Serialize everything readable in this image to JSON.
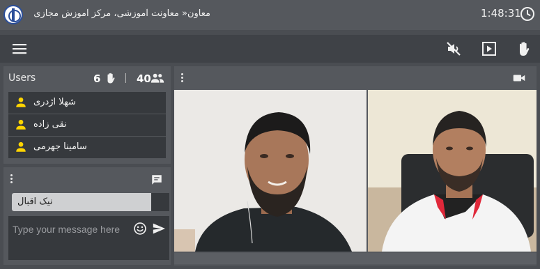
{
  "window": {
    "title": "معاون« معاونت آموزشی، مرکز آموزش مجازی",
    "clock": "1:48:31",
    "logo_icon": "university-seal-logo",
    "clock_icon": "clock-icon"
  },
  "toolbar": {
    "menu_icon": "hamburger-menu-icon",
    "mute_icon": "volume-off-icon",
    "play_icon": "play-box-icon",
    "hand_icon": "raise-hand-icon"
  },
  "users": {
    "title": "Users",
    "raised_hands_count": "6",
    "participants_count": "40",
    "list": [
      {
        "name": "شهلا اژدری",
        "icon": "person-icon"
      },
      {
        "name": "نقی زاده",
        "icon": "person-icon"
      },
      {
        "name": "سامینا جهرمی",
        "icon": "person-icon"
      }
    ]
  },
  "chat": {
    "header_icon": "chat-icon",
    "messages": [
      {
        "text": "نیک اقبال"
      }
    ],
    "composer": {
      "placeholder": "Type your message here",
      "value": ""
    },
    "emoji_icon": "emoji-icon",
    "send_icon": "send-icon"
  },
  "video": {
    "camera_icon": "video-camera-icon",
    "tiles": [
      {
        "participant": "left-video-feed"
      },
      {
        "participant": "right-video-feed"
      }
    ]
  },
  "colors": {
    "accent_yellow": "#ffd400",
    "panel": "#55585d",
    "panel_dark": "#36393d",
    "background": "#4a4d52"
  }
}
